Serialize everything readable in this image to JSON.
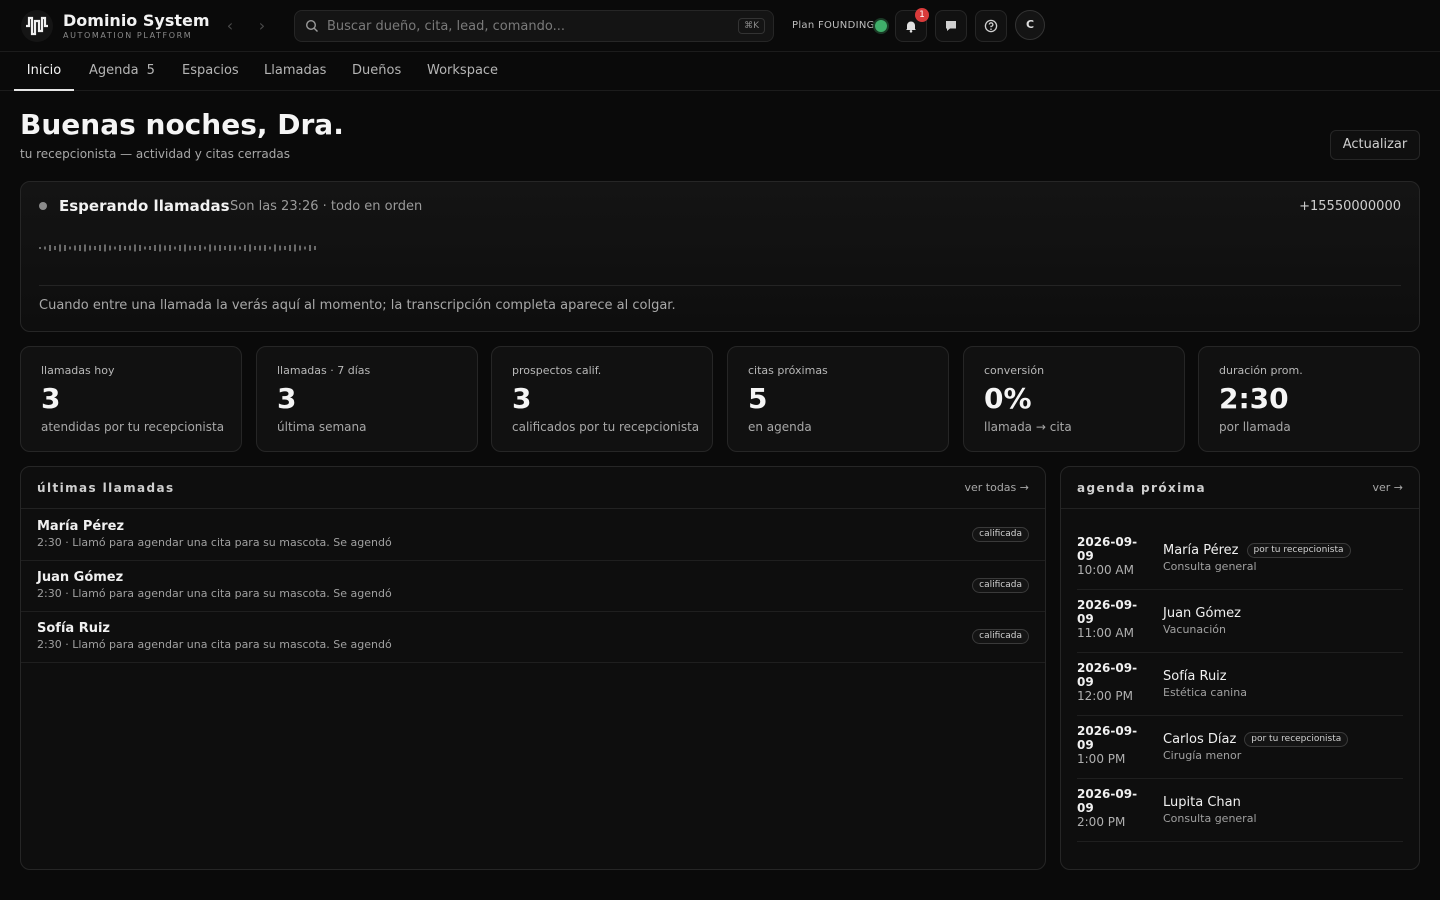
{
  "brand": {
    "name": "Dominio System",
    "subtitle": "AUTOMATION PLATFORM"
  },
  "search": {
    "placeholder": "Buscar dueño, cita, lead, comando...",
    "shortcut": "⌘K"
  },
  "plan": {
    "label": "Plan FOUNDING",
    "status_color": "#3fae6a"
  },
  "notifications": {
    "count": "1"
  },
  "user": {
    "initial": "C"
  },
  "icons": [
    "logo-icon",
    "back-arrow-icon",
    "forward-arrow-icon",
    "search-icon",
    "bell-icon",
    "chat-icon",
    "help-icon"
  ],
  "tabs": [
    {
      "label": "Inicio",
      "active": true
    },
    {
      "label": "Agenda",
      "count": "5"
    },
    {
      "label": "Espacios"
    },
    {
      "label": "Llamadas"
    },
    {
      "label": "Dueños"
    },
    {
      "label": "Workspace"
    }
  ],
  "header": {
    "greeting": "Buenas noches, Dra.",
    "subtitle": "tu recepcionista — actividad y citas cerradas",
    "refresh_label": "Actualizar"
  },
  "live": {
    "title": "Esperando llamadas",
    "status": "Son las 23:26 · todo en orden",
    "phone": "+15550000000",
    "hint": "Cuando entre una llamada la verás aquí al momento; la transcripción completa aparece al colgar."
  },
  "stats": [
    {
      "label": "llamadas hoy",
      "value": "3",
      "sub": "atendidas por tu recepcionista"
    },
    {
      "label": "llamadas · 7 días",
      "value": "3",
      "sub": "última semana"
    },
    {
      "label": "prospectos calif.",
      "value": "3",
      "sub": "calificados por tu recepcionista"
    },
    {
      "label": "citas próximas",
      "value": "5",
      "sub": "en agenda"
    },
    {
      "label": "conversión",
      "value": "0%",
      "sub": "llamada → cita"
    },
    {
      "label": "duración prom.",
      "value": "2:30",
      "sub": "por llamada"
    }
  ],
  "calls": {
    "title": "últimas llamadas",
    "link": "ver todas →",
    "items": [
      {
        "name": "María Pérez",
        "desc": "2:30 · Llamó para agendar una cita para su mascota. Se agendó",
        "tag": "calificada"
      },
      {
        "name": "Juan Gómez",
        "desc": "2:30 · Llamó para agendar una cita para su mascota. Se agendó",
        "tag": "calificada"
      },
      {
        "name": "Sofía Ruiz",
        "desc": "2:30 · Llamó para agendar una cita para su mascota. Se agendó",
        "tag": "calificada"
      }
    ]
  },
  "agenda": {
    "title": "agenda próxima",
    "link": "ver →",
    "items": [
      {
        "date": "2026-09-09",
        "time": "10:00 AM",
        "name": "María Pérez",
        "type": "Consulta general",
        "tag": "por tu recepcionista"
      },
      {
        "date": "2026-09-09",
        "time": "11:00 AM",
        "name": "Juan Gómez",
        "type": "Vacunación"
      },
      {
        "date": "2026-09-09",
        "time": "12:00 PM",
        "name": "Sofía Ruiz",
        "type": "Estética canina"
      },
      {
        "date": "2026-09-09",
        "time": "1:00 PM",
        "name": "Carlos Díaz",
        "type": "Cirugía menor",
        "tag": "por tu recepcionista"
      },
      {
        "date": "2026-09-09",
        "time": "2:00 PM",
        "name": "Lupita Chan",
        "type": "Consulta general"
      }
    ]
  }
}
